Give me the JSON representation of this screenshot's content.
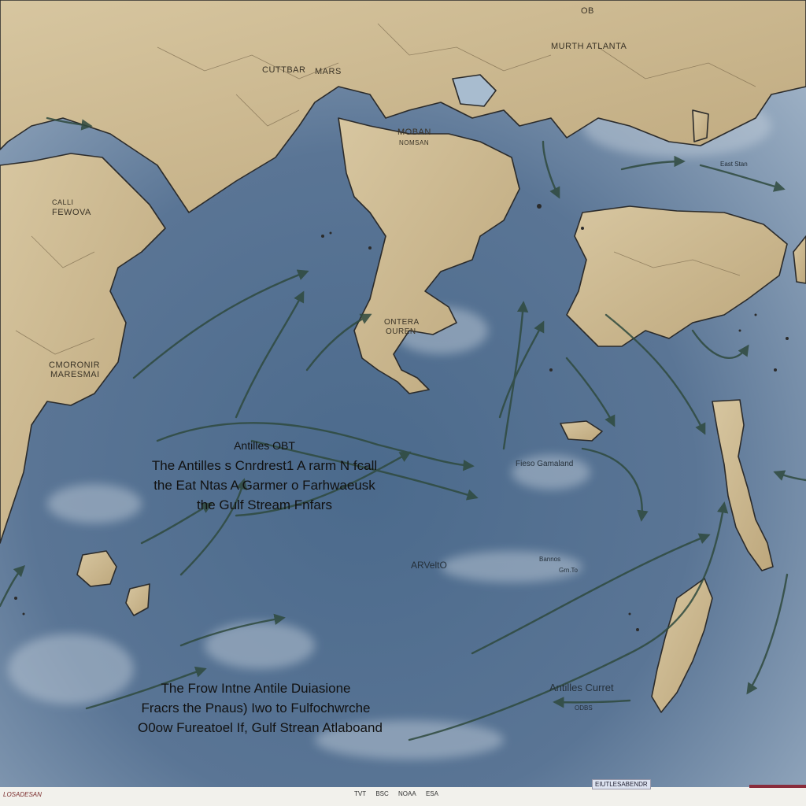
{
  "labels": {
    "north_atlanta": "MURTH ATLANTA",
    "cuttbar": "CUTTBAR",
    "mars": "MARS",
    "moban": "MOBAN",
    "moban_sub": "NOMSAN",
    "fewova_1": "CALLI",
    "fewova_2": "FEWOVA",
    "coronir_1": "CMORONIR",
    "coronir_2": "MARESMAI",
    "ontera_1": "ONTERA",
    "ontera_2": "OUREN",
    "fieso": "Fieso Gamaland",
    "arvelto": "ARVeltO",
    "antilles_current": "Antilles Curret",
    "antilles_current_sub": "ODBS",
    "top_corner": "OB",
    "east_small": "East Stan",
    "mid_small": "Bannos",
    "small_code": "Grn.To"
  },
  "caption_top": {
    "line0": "Antilles OBT",
    "line1": "The Antilles s Cnrdrest1 A rarm N fcall",
    "line2": "the Eat Ntas A Garmer o Farhwaeusk",
    "line3": "the Gulf Stream Fnfars"
  },
  "caption_bottom": {
    "line1": "The Frow Intne Antile Duiasione",
    "line2": "Fracrs the Pnaus) Iwo to Fulfochwrche",
    "line3": "O0ow Fureatoel If, Gulf Strean Atlaboand"
  },
  "footer": {
    "brand": "LOSADESAN",
    "tag": "EIUTLESABENDR",
    "logos": [
      "TVT",
      "BSC",
      "NOAA",
      "ESA"
    ]
  },
  "colors": {
    "ocean_deep": "#4b6586",
    "ocean_light": "#a6b6c7",
    "land": "#c9b690",
    "land_edge": "#2b2b2b",
    "current_arrow": "#2f4a3e"
  }
}
